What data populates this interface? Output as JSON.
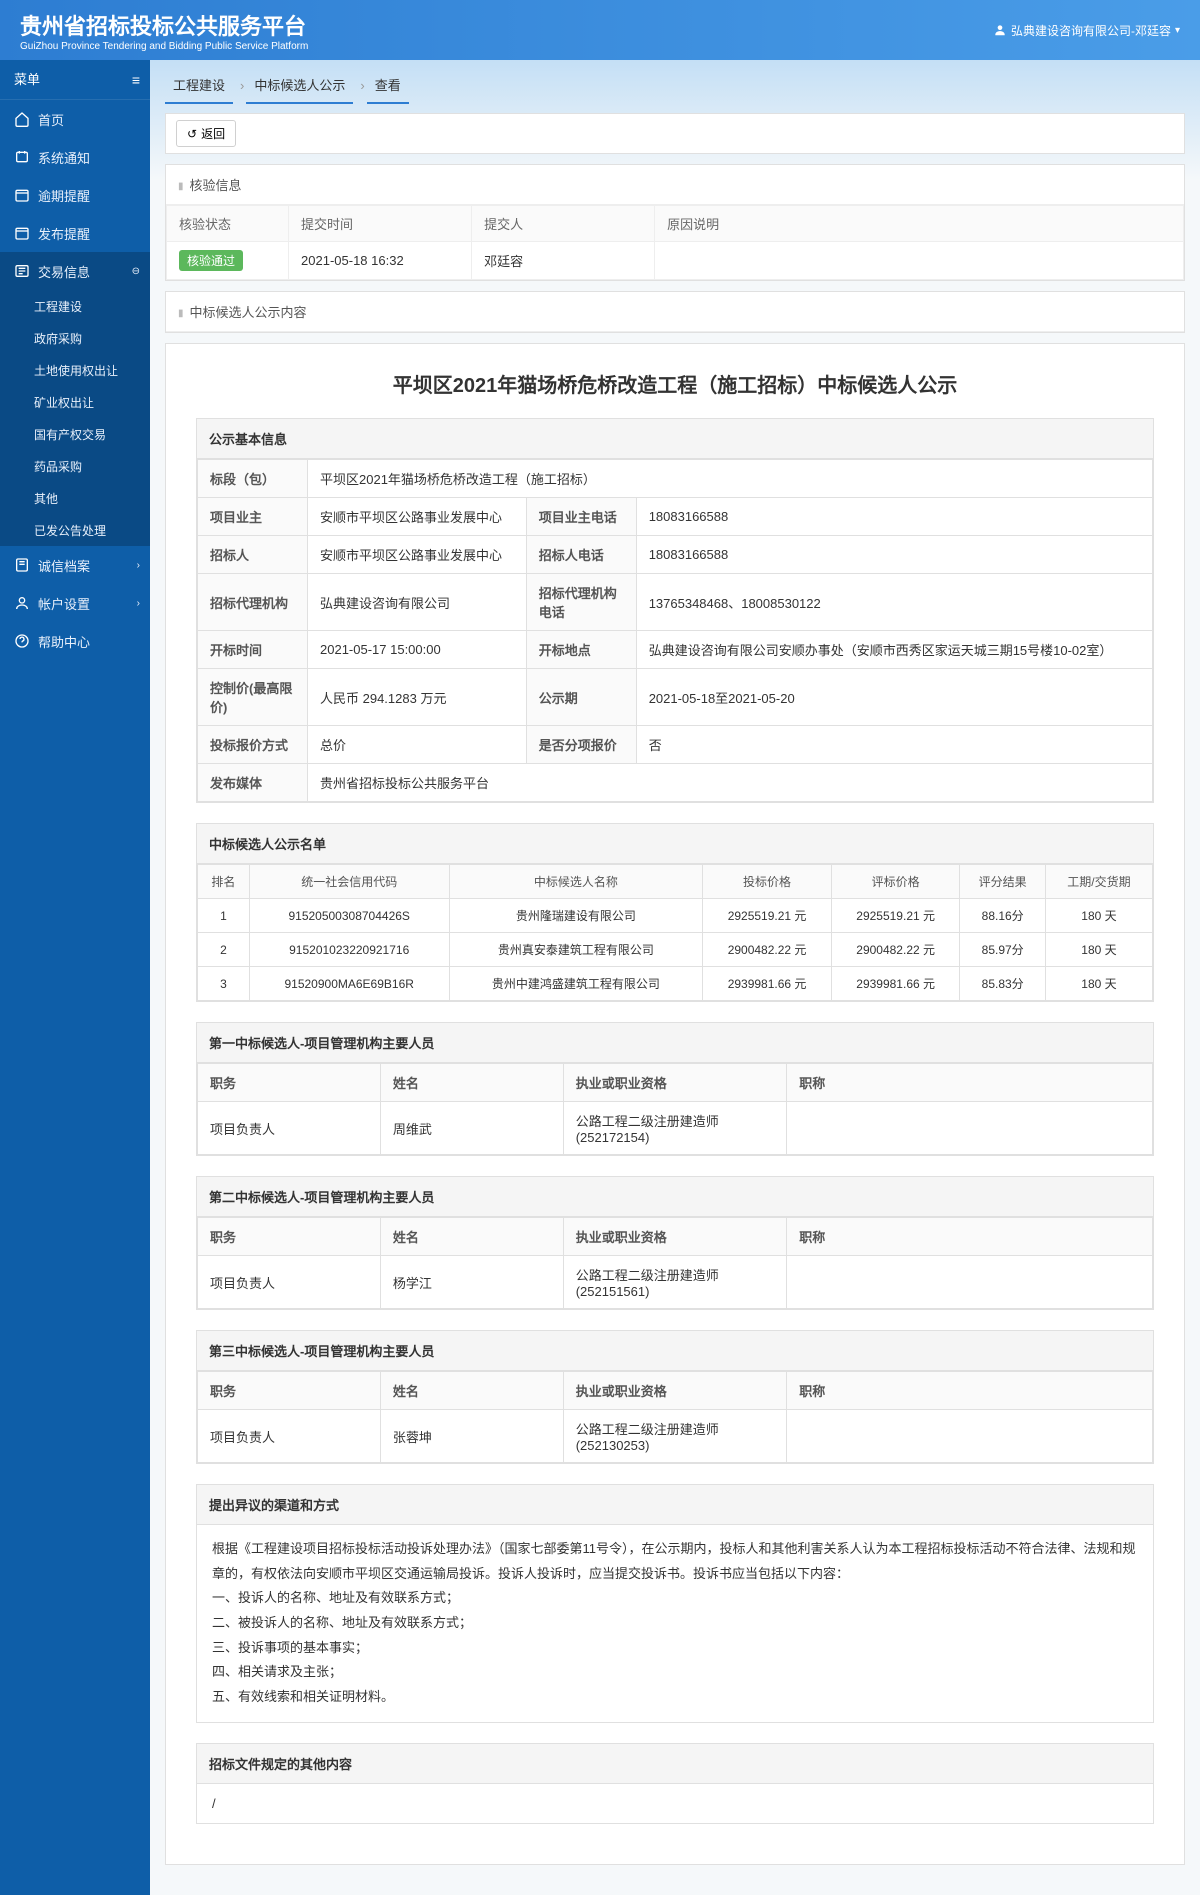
{
  "header": {
    "title_zh": "贵州省招标投标公共服务平台",
    "title_en": "GuiZhou Province Tendering and Bidding Public Service Platform",
    "user": "弘典建设咨询有限公司-邓廷容"
  },
  "sidebar": {
    "menu_label": "菜单",
    "items": [
      {
        "label": "首页",
        "icon": "home"
      },
      {
        "label": "系统通知",
        "icon": "bell"
      },
      {
        "label": "逾期提醒",
        "icon": "clock"
      },
      {
        "label": "发布提醒",
        "icon": "megaphone"
      },
      {
        "label": "交易信息",
        "icon": "folder",
        "active": true,
        "expanded": true
      },
      {
        "label": "诚信档案",
        "icon": "book",
        "chev": true
      },
      {
        "label": "帐户设置",
        "icon": "user",
        "chev": true
      },
      {
        "label": "帮助中心",
        "icon": "help"
      }
    ],
    "sub_items": [
      "工程建设",
      "政府采购",
      "土地使用权出让",
      "矿业权出让",
      "国有产权交易",
      "药品采购",
      "其他",
      "已发公告处理"
    ]
  },
  "breadcrumb": [
    "工程建设",
    "中标候选人公示",
    "查看"
  ],
  "back_label": "返回",
  "verify": {
    "title": "核验信息",
    "headers": [
      "核验状态",
      "提交时间",
      "提交人",
      "原因说明"
    ],
    "status_badge": "核验通过",
    "submit_time": "2021-05-18 16:32",
    "submitter": "邓廷容",
    "reason": ""
  },
  "content": {
    "panel_title": "中标候选人公示内容",
    "doc_title": "平坝区2021年猫场桥危桥改造工程（施工招标）中标候选人公示",
    "basic": {
      "title": "公示基本信息",
      "rows": {
        "section_label": "标段（包）",
        "section_val": "平坝区2021年猫场桥危桥改造工程（施工招标）",
        "owner_label": "项目业主",
        "owner_val": "安顺市平坝区公路事业发展中心",
        "owner_tel_label": "项目业主电话",
        "owner_tel_val": "18083166588",
        "tenderee_label": "招标人",
        "tenderee_val": "安顺市平坝区公路事业发展中心",
        "tenderee_tel_label": "招标人电话",
        "tenderee_tel_val": "18083166588",
        "agency_label": "招标代理机构",
        "agency_val": "弘典建设咨询有限公司",
        "agency_tel_label": "招标代理机构电话",
        "agency_tel_val": "13765348468、18008530122",
        "open_time_label": "开标时间",
        "open_time_val": "2021-05-17 15:00:00",
        "open_place_label": "开标地点",
        "open_place_val": "弘典建设咨询有限公司安顺办事处（安顺市西秀区家运天城三期15号楼10-02室）",
        "ctrl_price_label": "控制价(最高限价)",
        "ctrl_price_val": "人民币 294.1283 万元",
        "pub_period_label": "公示期",
        "pub_period_val": "2021-05-18至2021-05-20",
        "quote_method_label": "投标报价方式",
        "quote_method_val": "总价",
        "split_label": "是否分项报价",
        "split_val": "否",
        "media_label": "发布媒体",
        "media_val": "贵州省招标投标公共服务平台"
      }
    },
    "candidates": {
      "title": "中标候选人公示名单",
      "headers": [
        "排名",
        "统一社会信用代码",
        "中标候选人名称",
        "投标价格",
        "评标价格",
        "评分结果",
        "工期/交货期"
      ],
      "rows": [
        {
          "rank": "1",
          "code": "91520500308704426S",
          "name": "贵州隆瑞建设有限公司",
          "bid": "2925519.21 元",
          "eval": "2925519.21 元",
          "score": "88.16分",
          "period": "180 天"
        },
        {
          "rank": "2",
          "code": "915201023220921716",
          "name": "贵州真安泰建筑工程有限公司",
          "bid": "2900482.22 元",
          "eval": "2900482.22 元",
          "score": "85.97分",
          "period": "180 天"
        },
        {
          "rank": "3",
          "code": "91520900MA6E69B16R",
          "name": "贵州中建鸿盛建筑工程有限公司",
          "bid": "2939981.66 元",
          "eval": "2939981.66 元",
          "score": "85.83分",
          "period": "180 天"
        }
      ]
    },
    "personnel_sections": [
      {
        "title": "第一中标候选人-项目管理机构主要人员",
        "role": "项目负责人",
        "name": "周维武",
        "qual": "公路工程二级注册建造师(252172154)",
        "pos": ""
      },
      {
        "title": "第二中标候选人-项目管理机构主要人员",
        "role": "项目负责人",
        "name": "杨学江",
        "qual": "公路工程二级注册建造师(252151561)",
        "pos": ""
      },
      {
        "title": "第三中标候选人-项目管理机构主要人员",
        "role": "项目负责人",
        "name": "张蓉坤",
        "qual": "公路工程二级注册建造师(252130253)",
        "pos": ""
      }
    ],
    "personnel_headers": [
      "职务",
      "姓名",
      "执业或职业资格",
      "职称"
    ],
    "objection": {
      "title": "提出异议的渠道和方式",
      "lines": [
        "根据《工程建设项目招标投标活动投诉处理办法》（国家七部委第11号令），在公示期内，投标人和其他利害关系人认为本工程招标投标活动不符合法律、法规和规章的，有权依法向安顺市平坝区交通运输局投诉。投诉人投诉时，应当提交投诉书。投诉书应当包括以下内容：",
        "一、投诉人的名称、地址及有效联系方式；",
        "二、被投诉人的名称、地址及有效联系方式；",
        "三、投诉事项的基本事实；",
        "四、相关请求及主张；",
        "五、有效线索和相关证明材料。"
      ]
    },
    "other": {
      "title": "招标文件规定的其他内容",
      "text": "/"
    }
  }
}
